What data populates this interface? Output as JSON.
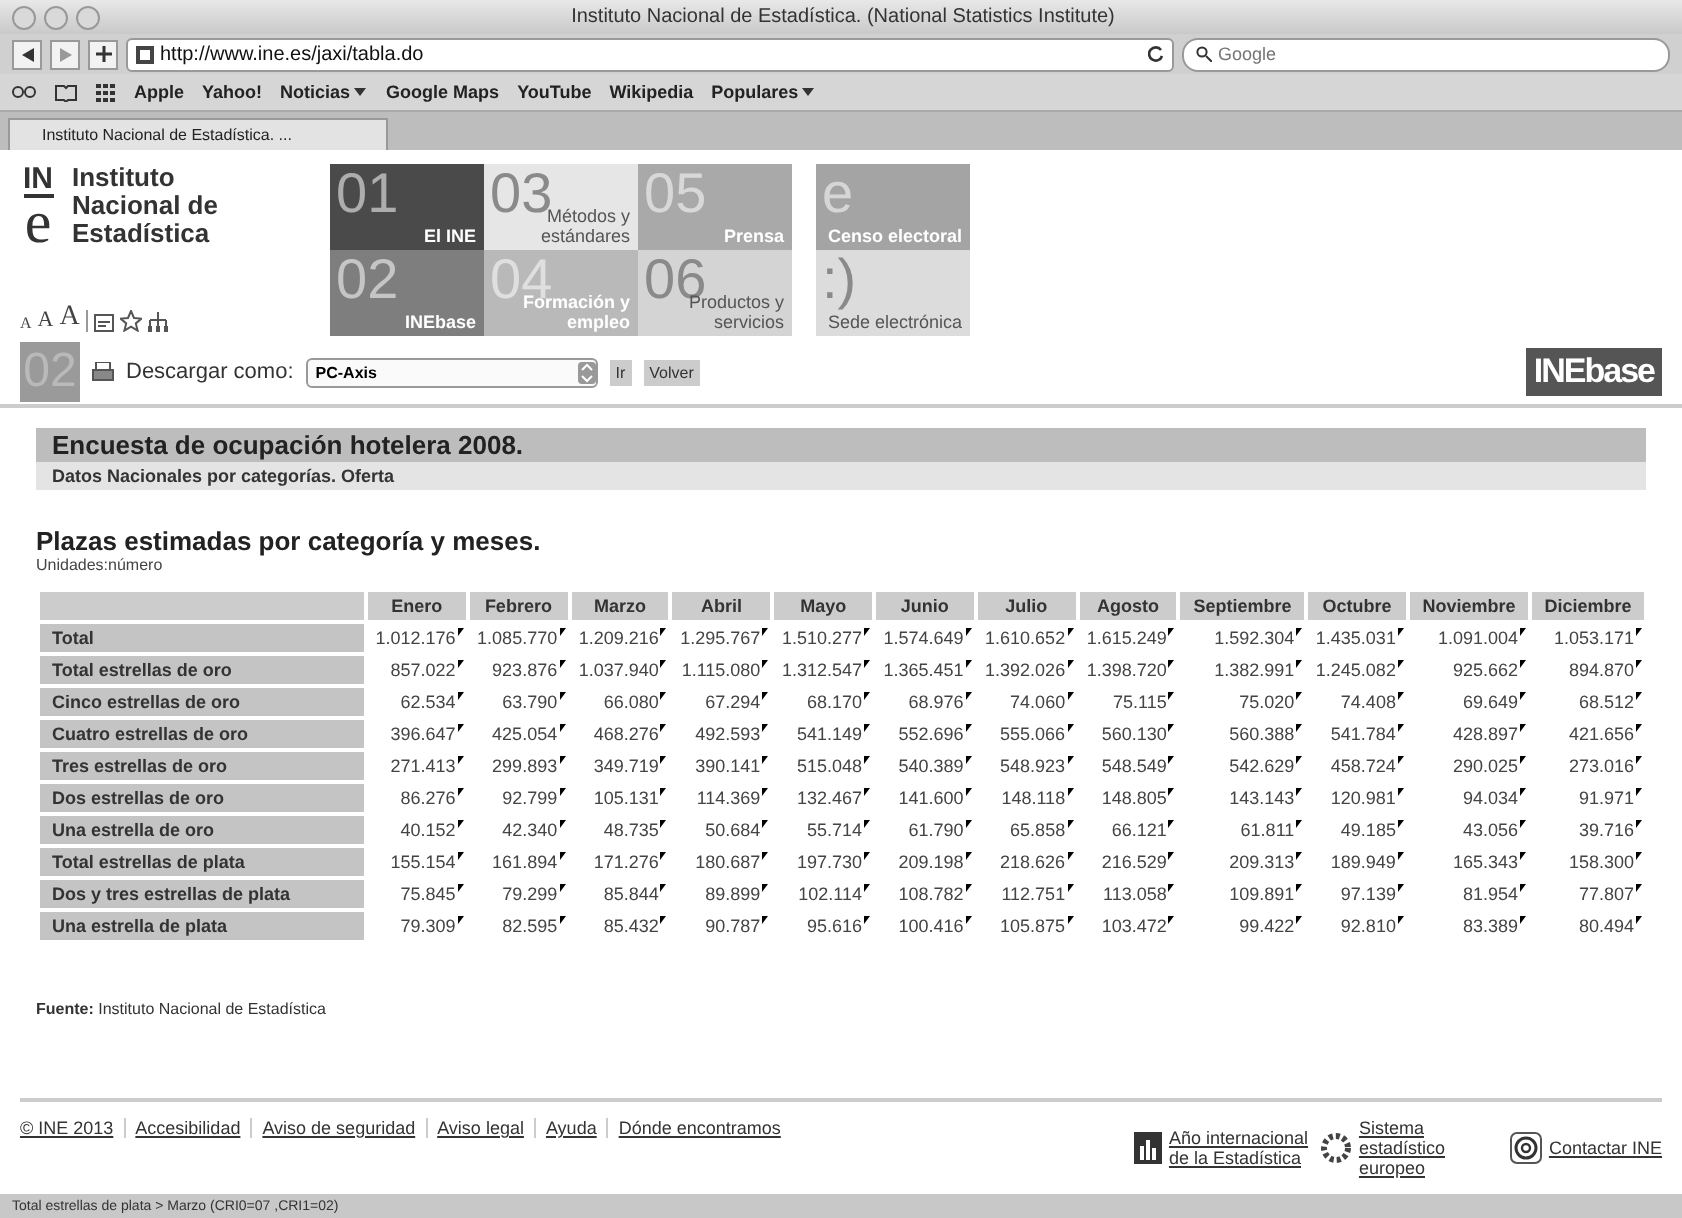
{
  "window": {
    "title": "Instituto Nacional de Estadística. (National Statistics Institute)"
  },
  "browser": {
    "url": "http://www.ine.es/jaxi/tabla.do",
    "search_placeholder": "Google",
    "bookmarks": [
      {
        "label": "Apple",
        "menu": false
      },
      {
        "label": "Yahoo!",
        "menu": false
      },
      {
        "label": "Noticias",
        "menu": true
      },
      {
        "label": "Google Maps",
        "menu": false
      },
      {
        "label": "YouTube",
        "menu": false
      },
      {
        "label": "Wikipedia",
        "menu": false
      },
      {
        "label": "Populares",
        "menu": true
      }
    ],
    "tabs": [
      {
        "label": "Instituto Nacional de Estadística. ...",
        "selected": true
      }
    ]
  },
  "logo": {
    "mark_top": "IN",
    "mark_bottom": "e",
    "name": "Instituto Nacional de Estadística",
    "font_sizes": [
      "A",
      "A",
      "A"
    ]
  },
  "tiles": [
    {
      "number": "01",
      "label": "El INE",
      "color": "#4a4a4a"
    },
    {
      "number": "03",
      "label": "Métodos y estándares",
      "color": "#e6e6e6"
    },
    {
      "number": "05",
      "label": "Prensa",
      "color": "#a9a9a9"
    },
    {
      "number": "02",
      "label": "INEbase",
      "color": "#7e7e7e"
    },
    {
      "number": "04",
      "label": "Formación y empleo",
      "color": "#b9b9b9"
    },
    {
      "number": "06",
      "label": "Productos y servicios",
      "color": "#d4d4d4"
    }
  ],
  "side_tiles": [
    {
      "number": "e",
      "label": "Censo electoral",
      "color": "#a4a4a4"
    },
    {
      "number": ":)",
      "label": "Sede electrónica",
      "color": "#dcdcdc"
    }
  ],
  "download": {
    "section": "02",
    "label": "Descargar como:",
    "format": "PC-Axis",
    "buttons": [
      "Ir",
      "Volver"
    ],
    "badge": "INEbase"
  },
  "survey": {
    "title": "Encuesta de ocupación hotelera 2008.",
    "subtitle": "Datos Nacionales por categorías. Oferta"
  },
  "table_title": "Plazas estimadas por categoría y meses.",
  "units": "Unidades:número",
  "table": {
    "columns": [
      "Enero",
      "Febrero",
      "Marzo",
      "Abril",
      "Mayo",
      "Junio",
      "Julio",
      "Agosto",
      "Septiembre",
      "Octubre",
      "Noviembre",
      "Diciembre"
    ],
    "rows": [
      {
        "label": "Total",
        "values": [
          "1.012.176",
          "1.085.770",
          "1.209.216",
          "1.295.767",
          "1.510.277",
          "1.574.649",
          "1.610.652",
          "1.615.249",
          "1.592.304",
          "1.435.031",
          "1.091.004",
          "1.053.171"
        ]
      },
      {
        "label": "Total estrellas de oro",
        "values": [
          "857.022",
          "923.876",
          "1.037.940",
          "1.115.080",
          "1.312.547",
          "1.365.451",
          "1.392.026",
          "1.398.720",
          "1.382.991",
          "1.245.082",
          "925.662",
          "894.870"
        ]
      },
      {
        "label": "Cinco estrellas de oro",
        "values": [
          "62.534",
          "63.790",
          "66.080",
          "67.294",
          "68.170",
          "68.976",
          "74.060",
          "75.115",
          "75.020",
          "74.408",
          "69.649",
          "68.512"
        ]
      },
      {
        "label": "Cuatro estrellas de oro",
        "values": [
          "396.647",
          "425.054",
          "468.276",
          "492.593",
          "541.149",
          "552.696",
          "555.066",
          "560.130",
          "560.388",
          "541.784",
          "428.897",
          "421.656"
        ]
      },
      {
        "label": "Tres estrellas de oro",
        "values": [
          "271.413",
          "299.893",
          "349.719",
          "390.141",
          "515.048",
          "540.389",
          "548.923",
          "548.549",
          "542.629",
          "458.724",
          "290.025",
          "273.016"
        ]
      },
      {
        "label": "Dos estrellas de oro",
        "values": [
          "86.276",
          "92.799",
          "105.131",
          "114.369",
          "132.467",
          "141.600",
          "148.118",
          "148.805",
          "143.143",
          "120.981",
          "94.034",
          "91.971"
        ]
      },
      {
        "label": "Una estrella de oro",
        "values": [
          "40.152",
          "42.340",
          "48.735",
          "50.684",
          "55.714",
          "61.790",
          "65.858",
          "66.121",
          "61.811",
          "49.185",
          "43.056",
          "39.716"
        ]
      },
      {
        "label": "Total estrellas de plata",
        "values": [
          "155.154",
          "161.894",
          "171.276",
          "180.687",
          "197.730",
          "209.198",
          "218.626",
          "216.529",
          "209.313",
          "189.949",
          "165.343",
          "158.300"
        ]
      },
      {
        "label": "Dos y tres estrellas de plata",
        "values": [
          "75.845",
          "79.299",
          "85.844",
          "89.899",
          "102.114",
          "108.782",
          "112.751",
          "113.058",
          "109.891",
          "97.139",
          "81.954",
          "77.807"
        ]
      },
      {
        "label": "Una estrella de plata",
        "values": [
          "79.309",
          "82.595",
          "85.432",
          "90.787",
          "95.616",
          "100.416",
          "105.875",
          "103.472",
          "99.422",
          "92.810",
          "83.389",
          "80.494"
        ]
      }
    ]
  },
  "source": {
    "label": "Fuente:",
    "text": "Instituto Nacional de Estadística"
  },
  "footer": {
    "links": [
      "© INE 2013",
      "Accesibilidad",
      "Aviso de seguridad",
      "Aviso legal",
      "Ayuda",
      "Dónde encontramos"
    ],
    "partners": [
      {
        "kind": "chart",
        "text": "Año internacional de la Estadística"
      },
      {
        "kind": "ring",
        "text": "Sistema estadístico europeo"
      },
      {
        "kind": "at",
        "text": "Contactar INE"
      }
    ]
  },
  "status_bar": "Total estrellas de plata > Marzo (CRI0=07 ,CRI1=02)"
}
